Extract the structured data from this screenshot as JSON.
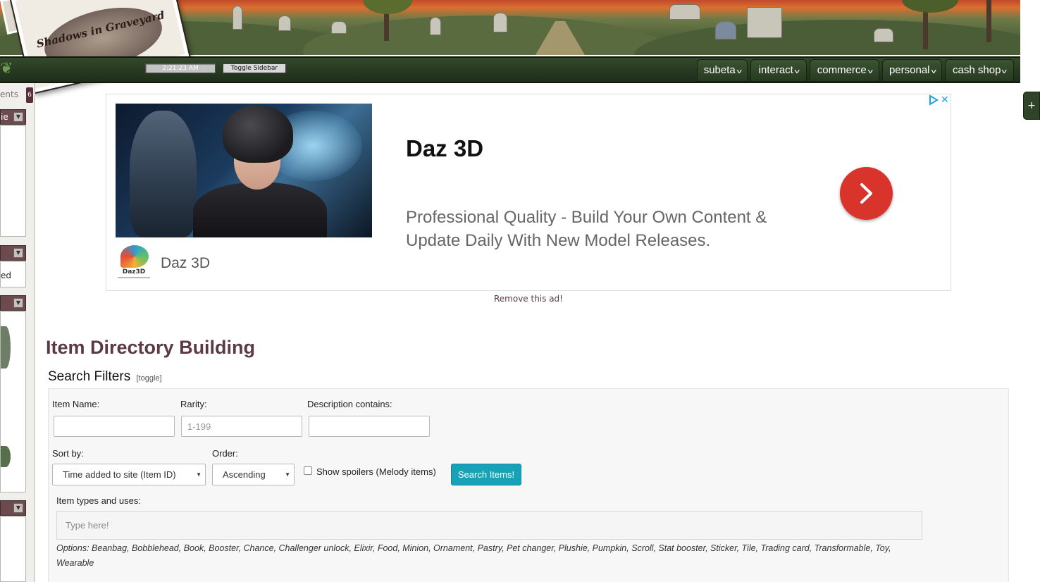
{
  "header": {
    "logo_text": "Shadows in Graveyard",
    "clock": "2:21:23 AM",
    "toggle_sidebar": "Toggle Sidebar"
  },
  "nav": {
    "tabs": [
      {
        "label": "subeta"
      },
      {
        "label": "interact"
      },
      {
        "label": "commerce"
      },
      {
        "label": "personal"
      },
      {
        "label": "cash shop"
      }
    ],
    "expander": "+"
  },
  "sidebar": {
    "top_label": "ents",
    "count": "6",
    "sections": [
      {
        "header": "ie",
        "body": ""
      },
      {
        "header": "",
        "body": "ed"
      },
      {
        "header": "",
        "body": ""
      },
      {
        "header": "",
        "body": ""
      }
    ]
  },
  "ad": {
    "title": "Daz 3D",
    "description": "Professional Quality - Build Your Own Content & Update Daily With New Model Releases.",
    "brand_name": "Daz 3D",
    "logo_text": "Daz3D",
    "remove_link": "Remove this ad!",
    "accent_color": "#d9342b"
  },
  "page": {
    "title": "Item Directory Building"
  },
  "filters": {
    "heading": "Search Filters",
    "toggle": "[toggle]",
    "item_name_label": "Item Name:",
    "item_name_value": "",
    "rarity_label": "Rarity:",
    "rarity_placeholder": "1-199",
    "description_label": "Description contains:",
    "description_value": "",
    "sort_label": "Sort by:",
    "sort_value": "Time added to site (Item ID)",
    "order_label": "Order:",
    "order_value": "Ascending",
    "spoilers_label": "Show spoilers (Melody items)",
    "search_button": "Search Items!",
    "types_label": "Item types and uses:",
    "types_placeholder": "Type here!",
    "options_text": "Options: Beanbag, Bobblehead, Book, Booster, Chance, Challenger unlock, Elixir, Food, Minion, Ornament, Pastry, Pet changer, Plushie, Pumpkin, Scroll, Stat booster, Sticker, Tile, Trading card, Transformable, Toy, Wearable",
    "button_color": "#17a2b8"
  }
}
